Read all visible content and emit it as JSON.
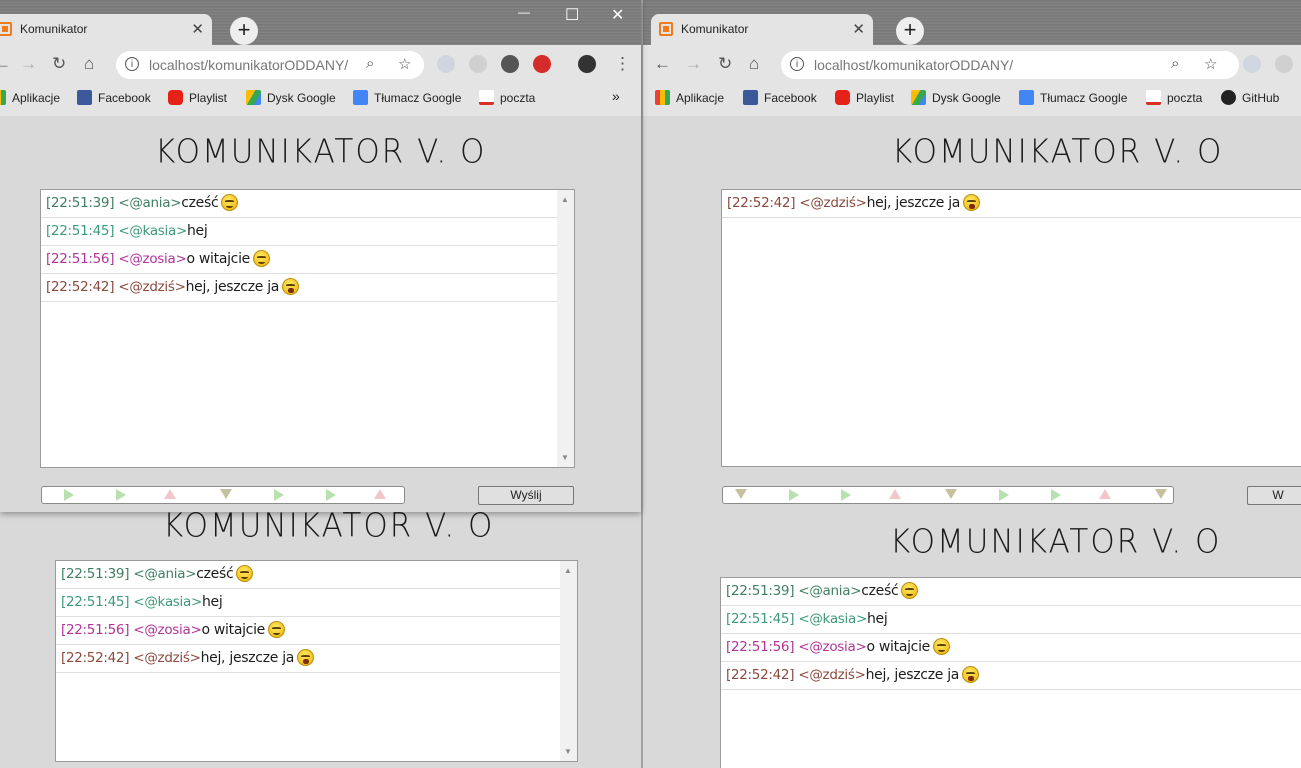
{
  "browser": {
    "tab_title": "Komunikator",
    "url_host": "localhost/",
    "url_path": "komunikatorODDANY/",
    "bookmarks": [
      "Aplikacje",
      "Facebook",
      "Playlist",
      "Dysk Google",
      "Tłumacz Google",
      "poczta",
      "GitHub"
    ],
    "more_bookmarks": "»",
    "new_tab": "+",
    "close_tab": "✕",
    "window_controls": {
      "minimize": "—",
      "maximize": "☐",
      "close": "✕"
    }
  },
  "app": {
    "heading": "KOMUNIKATOR V. O",
    "send_label": "Wyślij",
    "send_label_partial": "W"
  },
  "messages": [
    {
      "time": "[22:51:39]",
      "nick": "<@ania>",
      "text": "cześć",
      "emoji": "smile",
      "color": "#3f7f61"
    },
    {
      "time": "[22:51:45]",
      "nick": "<@kasia>",
      "text": "hej",
      "emoji": "",
      "color": "#3d9a78"
    },
    {
      "time": "[22:51:56]",
      "nick": "<@zosia>",
      "text": "o witajcie",
      "emoji": "smile",
      "color": "#b0349b"
    },
    {
      "time": "[22:52:42]",
      "nick": "<@zdziś>",
      "text": "hej, jeszcze ja",
      "emoji": "tongue",
      "color": "#8b4a3e"
    }
  ],
  "colors": {
    "nick_ania": "#3f7f61",
    "nick_kasia": "#3d9a78",
    "nick_zosia": "#b0349b",
    "nick_zdzis": "#8b4a3e",
    "tab_favicon": "#f07b1b",
    "page_background": "#d9d9d9"
  }
}
